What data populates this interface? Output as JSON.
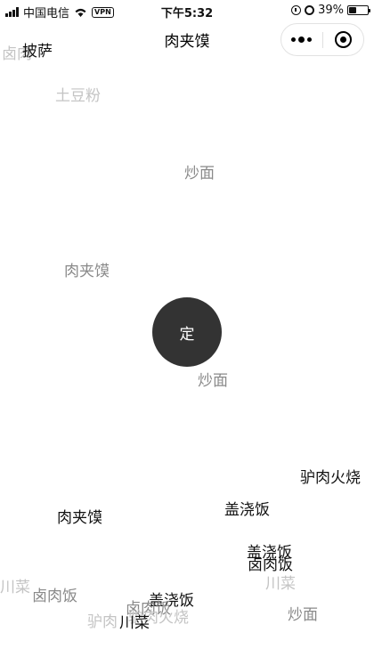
{
  "status_bar": {
    "carrier": "中国电信",
    "vpn_label": "VPN",
    "time": "下午5:32",
    "battery_percent": "39%",
    "battery_level": 0.39
  },
  "nav": {
    "title": "肉夹馍"
  },
  "decide_button": {
    "label": "定"
  },
  "floating_words": [
    "卤肉",
    "披萨",
    "土豆粉",
    "炒面",
    "肉夹馍",
    "炒面",
    "驴肉火烧",
    "盖浇饭",
    "肉夹馍",
    "盖浇饭",
    "卤肉饭",
    "川菜",
    "川菜",
    "卤肉饭",
    "盖浇饭",
    "卤肉饭",
    "驴肉火烧",
    "川菜",
    "驴肉",
    "炒面"
  ]
}
